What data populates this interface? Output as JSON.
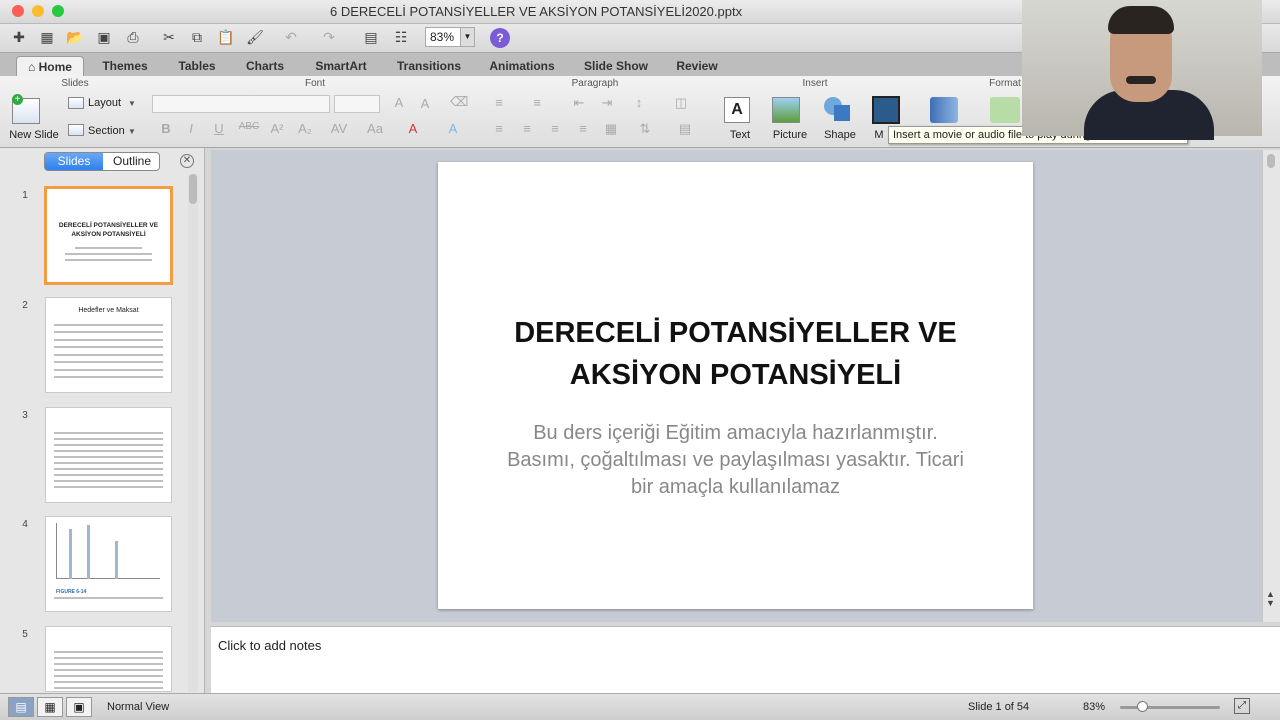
{
  "window": {
    "title": "6 DERECELİ POTANSİYELLER VE AKSİYON POTANSİYELİ2020.pptx"
  },
  "toolbar": {
    "zoom": "83%",
    "help": "?"
  },
  "tabs": [
    "Home",
    "Themes",
    "Tables",
    "Charts",
    "SmartArt",
    "Transitions",
    "Animations",
    "Slide Show",
    "Review"
  ],
  "ribbon": {
    "groups": {
      "slides": "Slides",
      "font": "Font",
      "paragraph": "Paragraph",
      "insert": "Insert",
      "format": "Format"
    },
    "new_slide": "New Slide",
    "layout": "Layout",
    "section": "Section",
    "insert_text": "Text",
    "insert_picture": "Picture",
    "insert_shape": "Shape",
    "insert_movie": "M"
  },
  "tooltip": "Insert a movie or audio file to play during the slide show",
  "panel": {
    "slides_tab": "Slides",
    "outline_tab": "Outline"
  },
  "thumbnails": [
    {
      "num": "1",
      "title": "DERECELİ POTANSİYELLER VE AKSİYON POTANSİYELİ"
    },
    {
      "num": "2",
      "title": "Hedefler ve Maksat"
    },
    {
      "num": "3",
      "title": ""
    },
    {
      "num": "4",
      "title": "FIGURE 6-14"
    },
    {
      "num": "5",
      "title": ""
    }
  ],
  "slide": {
    "title": "DERECELİ POTANSİYELLER VE AKSİYON POTANSİYELİ",
    "subtitle_line1": "Bu ders içeriği Eğitim amacıyla hazırlanmıştır.",
    "subtitle_line2": "Basımı, çoğaltılması ve paylaşılması yasaktır. Ticari bir amaçla kullanılamaz"
  },
  "notes": {
    "placeholder": "Click to add notes"
  },
  "status": {
    "view": "Normal View",
    "slide_pos": "Slide 1 of 54",
    "zoom": "83%"
  },
  "colors": {
    "selected_thumb": "#f39c42",
    "active_seg": "#2e7ff0",
    "canvas": "#c7cbd3"
  }
}
